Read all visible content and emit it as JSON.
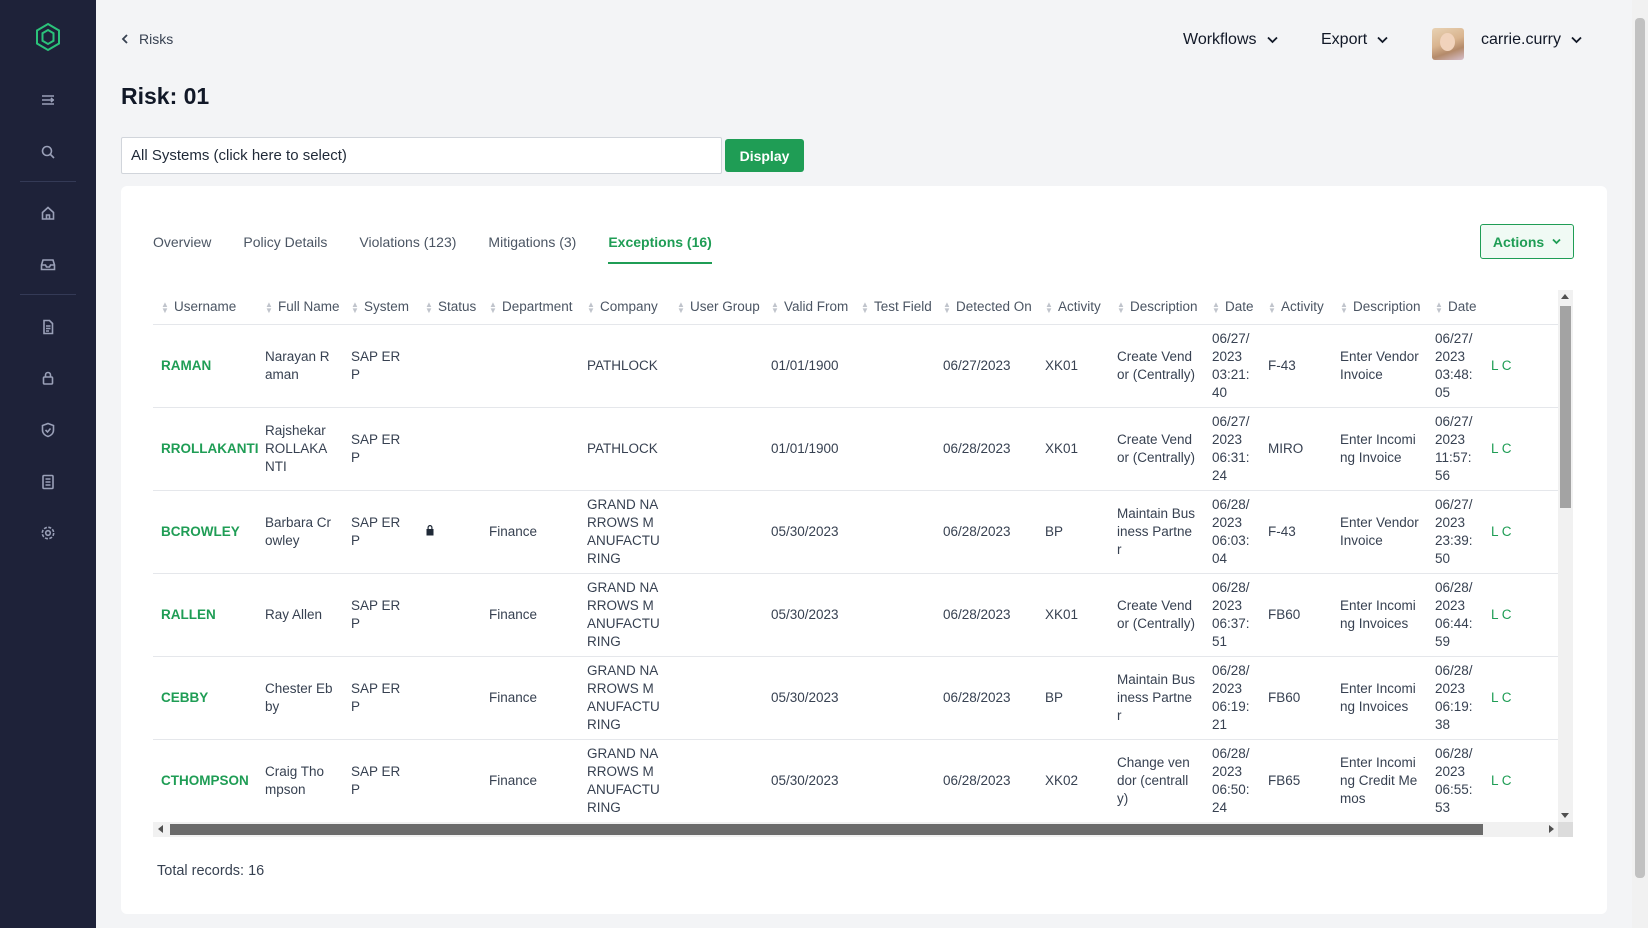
{
  "breadcrumb": {
    "label": "Risks"
  },
  "page": {
    "title": "Risk: 01"
  },
  "header": {
    "workflows_label": "Workflows",
    "export_label": "Export",
    "username": "carrie.curry"
  },
  "system_selector": {
    "value": "All Systems (click here to select)"
  },
  "display_button": "Display",
  "actions_button": "Actions",
  "tabs": [
    {
      "label": "Overview",
      "active": false
    },
    {
      "label": "Policy Details",
      "active": false
    },
    {
      "label": "Violations (123)",
      "active": false
    },
    {
      "label": "Mitigations (3)",
      "active": false
    },
    {
      "label": "Exceptions (16)",
      "active": true
    }
  ],
  "table": {
    "columns": [
      "Username",
      "Full Name",
      "System",
      "Status",
      "Department",
      "Company",
      "User Group",
      "Valid From",
      "Test Field",
      "Detected On",
      "Activity",
      "Description",
      "Date",
      "Activity",
      "Description",
      "Date"
    ],
    "rows": [
      {
        "username": "RAMAN",
        "full_name": "Narayan Raman",
        "system": "SAP ERP",
        "locked": false,
        "department": "",
        "company": "PATHLOCK",
        "user_group": "",
        "valid_from": "01/01/1900",
        "test_field": "",
        "detected_on": "06/27/2023",
        "activity1": "XK01",
        "description1": "Create Vendor (Centrally)",
        "date1": "06/27/2023 03:21:40",
        "activity2": "F-43",
        "description2": "Enter Vendor Invoice",
        "date2": "06/27/2023 03:48:05",
        "extra": "L C"
      },
      {
        "username": "RROLLAKANTI",
        "full_name": "Rajshekar ROLLAKANTI",
        "system": "SAP ERP",
        "locked": false,
        "department": "",
        "company": "PATHLOCK",
        "user_group": "",
        "valid_from": "01/01/1900",
        "test_field": "",
        "detected_on": "06/28/2023",
        "activity1": "XK01",
        "description1": "Create Vendor (Centrally)",
        "date1": "06/27/2023 06:31:24",
        "activity2": "MIRO",
        "description2": "Enter Incoming Invoice",
        "date2": "06/27/2023 11:57:56",
        "extra": "L C"
      },
      {
        "username": "BCROWLEY",
        "full_name": "Barbara Crowley",
        "system": "SAP ERP",
        "locked": true,
        "department": "Finance",
        "company": "GRAND NARROWS MANUFACTURING",
        "user_group": "",
        "valid_from": "05/30/2023",
        "test_field": "",
        "detected_on": "06/28/2023",
        "activity1": "BP",
        "description1": "Maintain Business Partner",
        "date1": "06/28/2023 06:03:04",
        "activity2": "F-43",
        "description2": "Enter Vendor Invoice",
        "date2": "06/27/2023 23:39:50",
        "extra": "L C"
      },
      {
        "username": "RALLEN",
        "full_name": "Ray Allen",
        "system": "SAP ERP",
        "locked": false,
        "department": "Finance",
        "company": "GRAND NARROWS MANUFACTURING",
        "user_group": "",
        "valid_from": "05/30/2023",
        "test_field": "",
        "detected_on": "06/28/2023",
        "activity1": "XK01",
        "description1": "Create Vendor (Centrally)",
        "date1": "06/28/2023 06:37:51",
        "activity2": "FB60",
        "description2": "Enter Incoming Invoices",
        "date2": "06/28/2023 06:44:59",
        "extra": "L C"
      },
      {
        "username": "CEBBY",
        "full_name": "Chester Ebby",
        "system": "SAP ERP",
        "locked": false,
        "department": "Finance",
        "company": "GRAND NARROWS MANUFACTURING",
        "user_group": "",
        "valid_from": "05/30/2023",
        "test_field": "",
        "detected_on": "06/28/2023",
        "activity1": "BP",
        "description1": "Maintain Business Partner",
        "date1": "06/28/2023 06:19:21",
        "activity2": "FB60",
        "description2": "Enter Incoming Invoices",
        "date2": "06/28/2023 06:19:38",
        "extra": "L C"
      },
      {
        "username": "CTHOMPSON",
        "full_name": "Craig Thompson",
        "system": "SAP ERP",
        "locked": false,
        "department": "Finance",
        "company": "GRAND NARROWS MANUFACTURING",
        "user_group": "",
        "valid_from": "05/30/2023",
        "test_field": "",
        "detected_on": "06/28/2023",
        "activity1": "XK02",
        "description1": "Change vendor (centrally)",
        "date1": "06/28/2023 06:50:24",
        "activity2": "FB65",
        "description2": "Enter Incoming Credit Memos",
        "date2": "06/28/2023 06:55:53",
        "extra": "L C"
      }
    ]
  },
  "footer": {
    "total_records": "Total records: 16"
  },
  "sidebar": {
    "icons": [
      "menu-icon",
      "search-icon",
      "home-icon",
      "inbox-icon",
      "document-icon",
      "lock-icon",
      "shield-icon",
      "list-icon",
      "gear-icon"
    ]
  },
  "colors": {
    "accent": "#1f9d55",
    "sidebar": "#1e2239"
  }
}
